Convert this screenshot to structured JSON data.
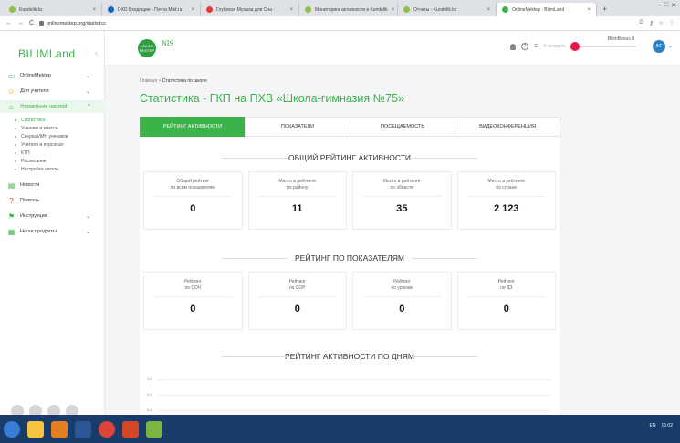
{
  "browser": {
    "tabs": [
      {
        "title": "Kundelik.kz",
        "color": "#8bc34a"
      },
      {
        "title": "DXD Входящие - Почта Mail.ru",
        "color": "#1565c0"
      },
      {
        "title": "Глубокая Музыка для Сна - ",
        "color": "#e53935"
      },
      {
        "title": "Мониторинг активности в Kundelik",
        "color": "#8bc34a"
      },
      {
        "title": "Отчеты - Kundelik.kz",
        "color": "#8bc34a"
      },
      {
        "title": "OnlineMektep - BilimLand",
        "color": "#3bb24a",
        "active": true
      }
    ],
    "url": "onlinemektep.org/statistics"
  },
  "sidebar": {
    "logo": "BILIMLand",
    "items": [
      {
        "label": "OnlineMektep",
        "icon": "monitor-icon",
        "chev": "⌄"
      },
      {
        "label": "Для учителя",
        "icon": "teacher-icon",
        "chev": "⌄"
      },
      {
        "label": "Управление школой",
        "icon": "school-icon",
        "chev": "^"
      },
      {
        "label": "Новости",
        "icon": "news-icon",
        "chev": ""
      },
      {
        "label": "Помощь",
        "icon": "help-icon",
        "chev": ""
      },
      {
        "label": "Инструкции",
        "icon": "instructions-icon",
        "chev": "⌄"
      },
      {
        "label": "Наши продукты",
        "icon": "products-icon",
        "chev": "⌄"
      }
    ],
    "subitems": [
      "Статистика",
      "Ученики и классы",
      "Сверка ИИН учеников",
      "Учителя и персонал",
      "КТП",
      "Расписание",
      "Настройка школы"
    ]
  },
  "header": {
    "logo_text": "ONLINE MEKTEP",
    "nis": "NIS",
    "quarter": "4 четверть",
    "bilim": "BilimBonus 0",
    "avatar": "ЖГ"
  },
  "main": {
    "breadcrumb_home": "Главная",
    "breadcrumb_sep": ">",
    "breadcrumb_current": "Статистика по школе",
    "title": "Статистика - ГКП на ПХВ «Школа-гимназия №75»",
    "tabs": [
      "РЕЙТИНГ АКТИВНОСТИ",
      "ПОКАЗАТЕЛИ",
      "ПОСЕЩАЕМОСТЬ",
      "ВИДЕОКОНФЕРЕНЦИЯ"
    ],
    "sec1": "ОБЩИЙ РЕЙТИНГ АКТИВНОСТИ",
    "cards1": [
      {
        "l1": "Общий рейтинг",
        "l2": "по всем показателям",
        "v": "0"
      },
      {
        "l1": "Место в рейтинге",
        "l2": "по району",
        "v": "11"
      },
      {
        "l1": "Место в рейтинге",
        "l2": "по области",
        "v": "35"
      },
      {
        "l1": "Место в рейтинге",
        "l2": "по стране",
        "v": "2 123"
      }
    ],
    "sec2": "РЕЙТИНГ ПО ПОКАЗАТЕЛЯМ",
    "cards2": [
      {
        "l1": "Рейтинг",
        "l2": "по СОЧ",
        "v": "0"
      },
      {
        "l1": "Рейтинг",
        "l2": "по СОР",
        "v": "0"
      },
      {
        "l1": "Рейтинг",
        "l2": "по урокам",
        "v": "0"
      },
      {
        "l1": "Рейтинг",
        "l2": "по ДЗ",
        "v": "0"
      }
    ],
    "sec3": "РЕЙТИНГ АКТИВНОСТИ ПО ДНЯМ",
    "chart_ticks": [
      "1.0",
      "0.9",
      "0.8"
    ]
  },
  "taskbar": {
    "lang": "EN",
    "time": "15:02"
  }
}
